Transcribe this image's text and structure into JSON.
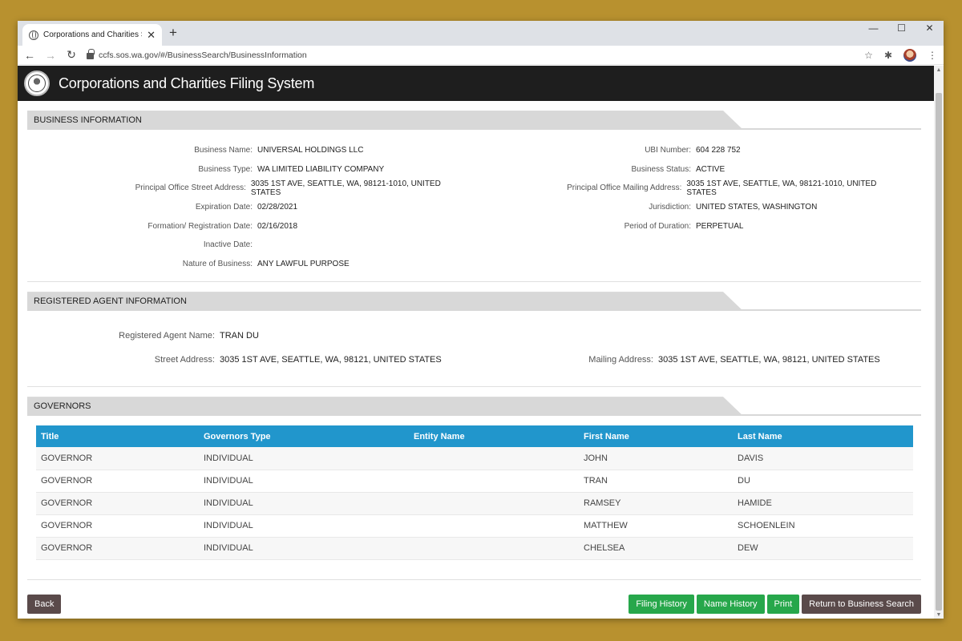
{
  "browser": {
    "tab_title": "Corporations and Charities Syste",
    "tab_close": "✕",
    "new_tab": "+",
    "url": "ccfs.sos.wa.gov/#/BusinessSearch/BusinessInformation",
    "window_controls": [
      "—",
      "☐",
      "✕"
    ]
  },
  "site": {
    "title": "Corporations and Charities Filing System"
  },
  "business_info": {
    "section_title": "BUSINESS INFORMATION",
    "left": [
      {
        "label": "Business Name:",
        "value": "UNIVERSAL HOLDINGS LLC"
      },
      {
        "label": "Business Type:",
        "value": "WA LIMITED LIABILITY COMPANY"
      },
      {
        "label": "Principal Office Street Address:",
        "value": "3035 1ST AVE, SEATTLE, WA, 98121-1010, UNITED STATES"
      },
      {
        "label": "Expiration Date:",
        "value": "02/28/2021"
      },
      {
        "label": "Formation/ Registration Date:",
        "value": "02/16/2018"
      },
      {
        "label": "Inactive Date:",
        "value": ""
      },
      {
        "label": "Nature of Business:",
        "value": "ANY LAWFUL PURPOSE"
      }
    ],
    "right": [
      {
        "label": "UBI Number:",
        "value": "604 228 752"
      },
      {
        "label": "Business Status:",
        "value": "ACTIVE"
      },
      {
        "label": "Principal Office Mailing Address:",
        "value": "3035 1ST AVE, SEATTLE, WA, 98121-1010, UNITED STATES"
      },
      {
        "label": "Jurisdiction:",
        "value": "UNITED STATES, WASHINGTON"
      },
      {
        "label": "Period of Duration:",
        "value": "PERPETUAL"
      }
    ]
  },
  "registered_agent": {
    "section_title": "REGISTERED AGENT INFORMATION",
    "name_label": "Registered Agent Name:",
    "name_value": "TRAN DU",
    "street_label": "Street Address:",
    "street_value": "3035 1ST AVE, SEATTLE, WA, 98121, UNITED STATES",
    "mailing_label": "Mailing Address:",
    "mailing_value": "3035 1ST AVE, SEATTLE, WA, 98121, UNITED STATES"
  },
  "governors": {
    "section_title": "GOVERNORS",
    "columns": [
      "Title",
      "Governors Type",
      "Entity Name",
      "First Name",
      "Last Name"
    ],
    "rows": [
      [
        "GOVERNOR",
        "INDIVIDUAL",
        "",
        "JOHN",
        "DAVIS"
      ],
      [
        "GOVERNOR",
        "INDIVIDUAL",
        "",
        "TRAN",
        "DU"
      ],
      [
        "GOVERNOR",
        "INDIVIDUAL",
        "",
        "RAMSEY",
        "HAMIDE"
      ],
      [
        "GOVERNOR",
        "INDIVIDUAL",
        "",
        "MATTHEW",
        "SCHOENLEIN"
      ],
      [
        "GOVERNOR",
        "INDIVIDUAL",
        "",
        "CHELSEA",
        "DEW"
      ]
    ]
  },
  "actions": {
    "back": "Back",
    "filing_history": "Filing History",
    "name_history": "Name History",
    "print": "Print",
    "return": "Return to Business Search"
  },
  "colors": {
    "table_header": "#2196cc",
    "action_green": "#27a74b",
    "action_dark": "#5a4a4a",
    "site_header": "#1e1e1e"
  }
}
